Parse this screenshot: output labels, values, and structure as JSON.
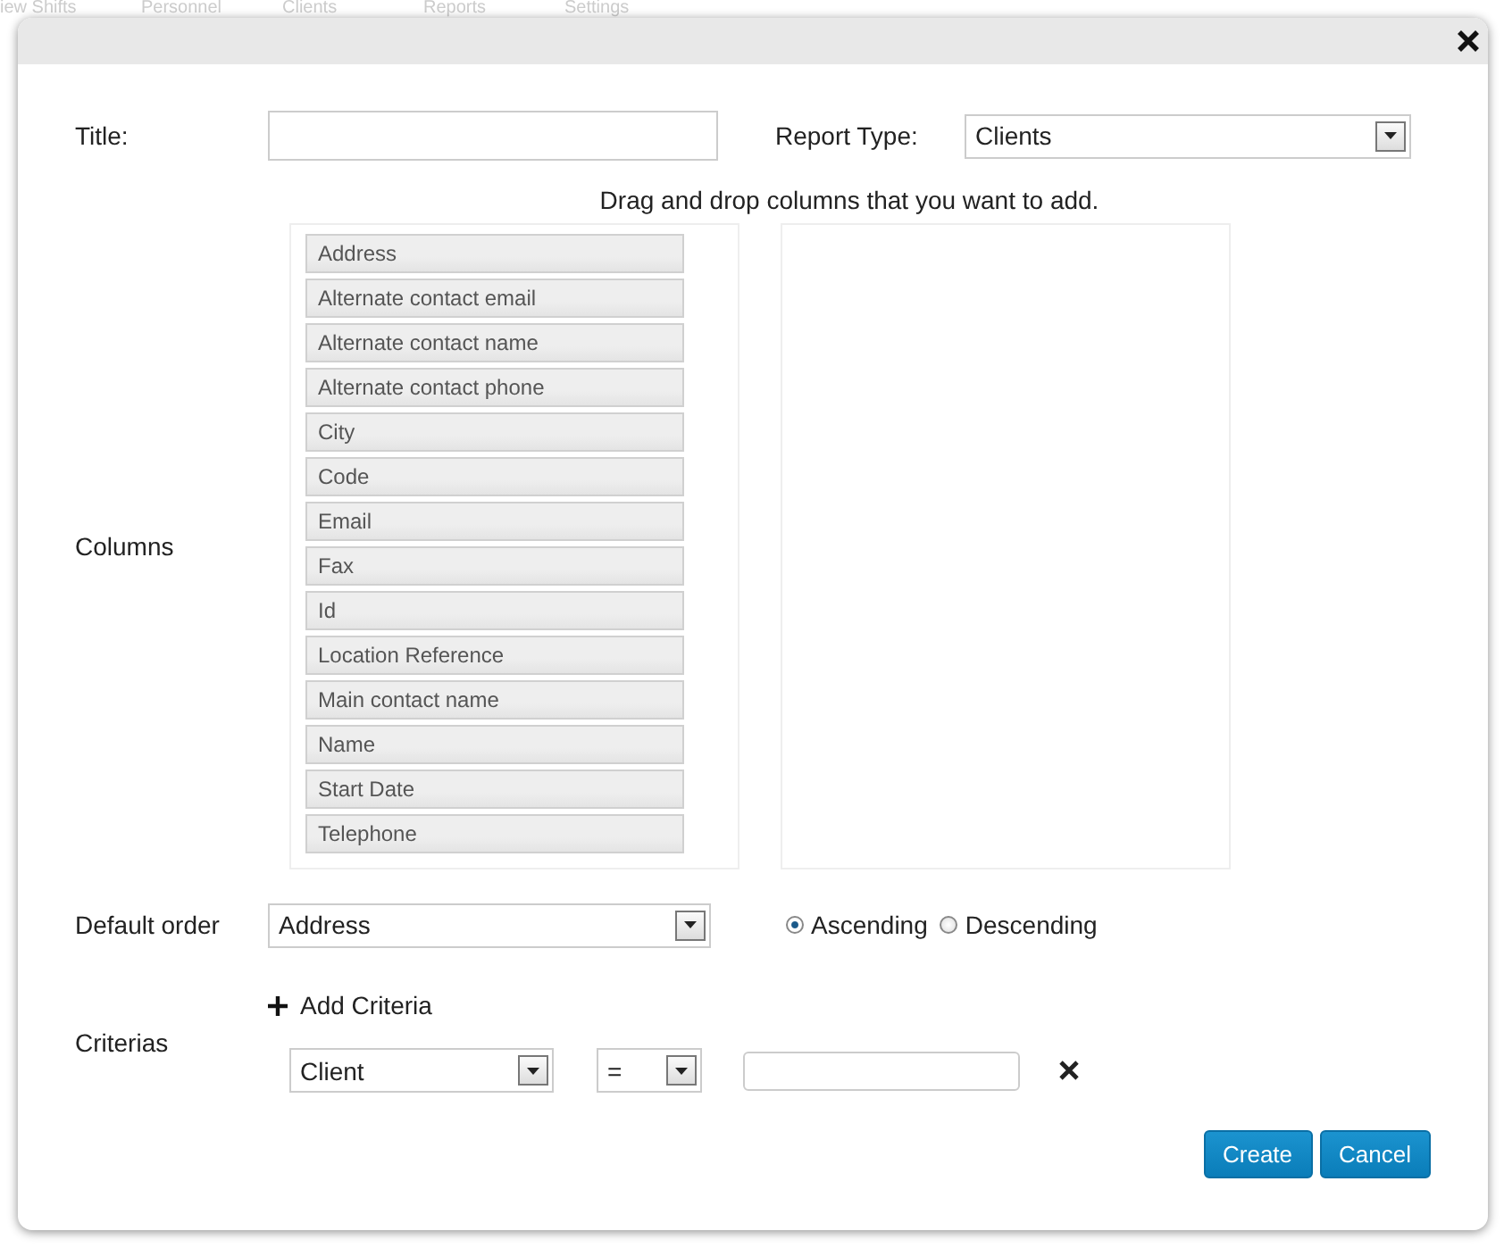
{
  "background_nav": [
    "iew Shifts",
    "Personnel",
    "Clients",
    "Reports",
    "Settings"
  ],
  "title_field": {
    "label": "Title:"
  },
  "report_type": {
    "label": "Report Type:",
    "value": "Clients"
  },
  "columns": {
    "hint": "Drag and drop columns that you want to add.",
    "label": "Columns",
    "available": [
      "Address",
      "Alternate contact email",
      "Alternate contact name",
      "Alternate contact phone",
      "City",
      "Code",
      "Email",
      "Fax",
      "Id",
      "Location Reference",
      "Main contact name",
      "Name",
      "Start Date",
      "Telephone"
    ]
  },
  "default_order": {
    "label": "Default order",
    "value": "Address",
    "directions": [
      {
        "label": "Ascending",
        "selected": true
      },
      {
        "label": "Descending",
        "selected": false
      }
    ]
  },
  "criteria": {
    "add_label": "Add Criteria",
    "label": "Criterias",
    "rows": [
      {
        "field": "Client",
        "operator": "="
      }
    ]
  },
  "buttons": [
    "Create",
    "Cancel"
  ]
}
